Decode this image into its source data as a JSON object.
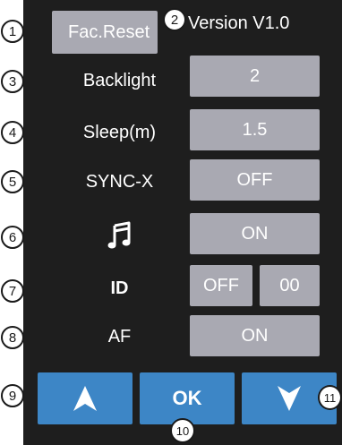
{
  "header": {
    "factory_reset_label": "Fac.Reset",
    "version_text": "Version V1.0"
  },
  "settings": {
    "backlight": {
      "label": "Backlight",
      "value": "2"
    },
    "sleep": {
      "label": "Sleep(m)",
      "value": "1.5"
    },
    "sync": {
      "label": "SYNC-X",
      "value": "OFF"
    },
    "sound": {
      "icon": "music-note-icon",
      "value": "ON"
    },
    "id": {
      "label": "ID",
      "toggle_value": "OFF",
      "number_value": "00"
    },
    "af": {
      "label": "AF",
      "value": "ON"
    }
  },
  "nav": {
    "up_icon": "arrow-up-icon",
    "ok_label": "OK",
    "down_icon": "arrow-down-icon"
  },
  "callouts": [
    "1",
    "2",
    "3",
    "4",
    "5",
    "6",
    "7",
    "8",
    "9",
    "10",
    "11"
  ],
  "colors": {
    "panel_bg": "#1e1e1e",
    "button_gray": "#a9a9b2",
    "nav_blue": "#3d86c6",
    "text_white": "#ffffff"
  }
}
